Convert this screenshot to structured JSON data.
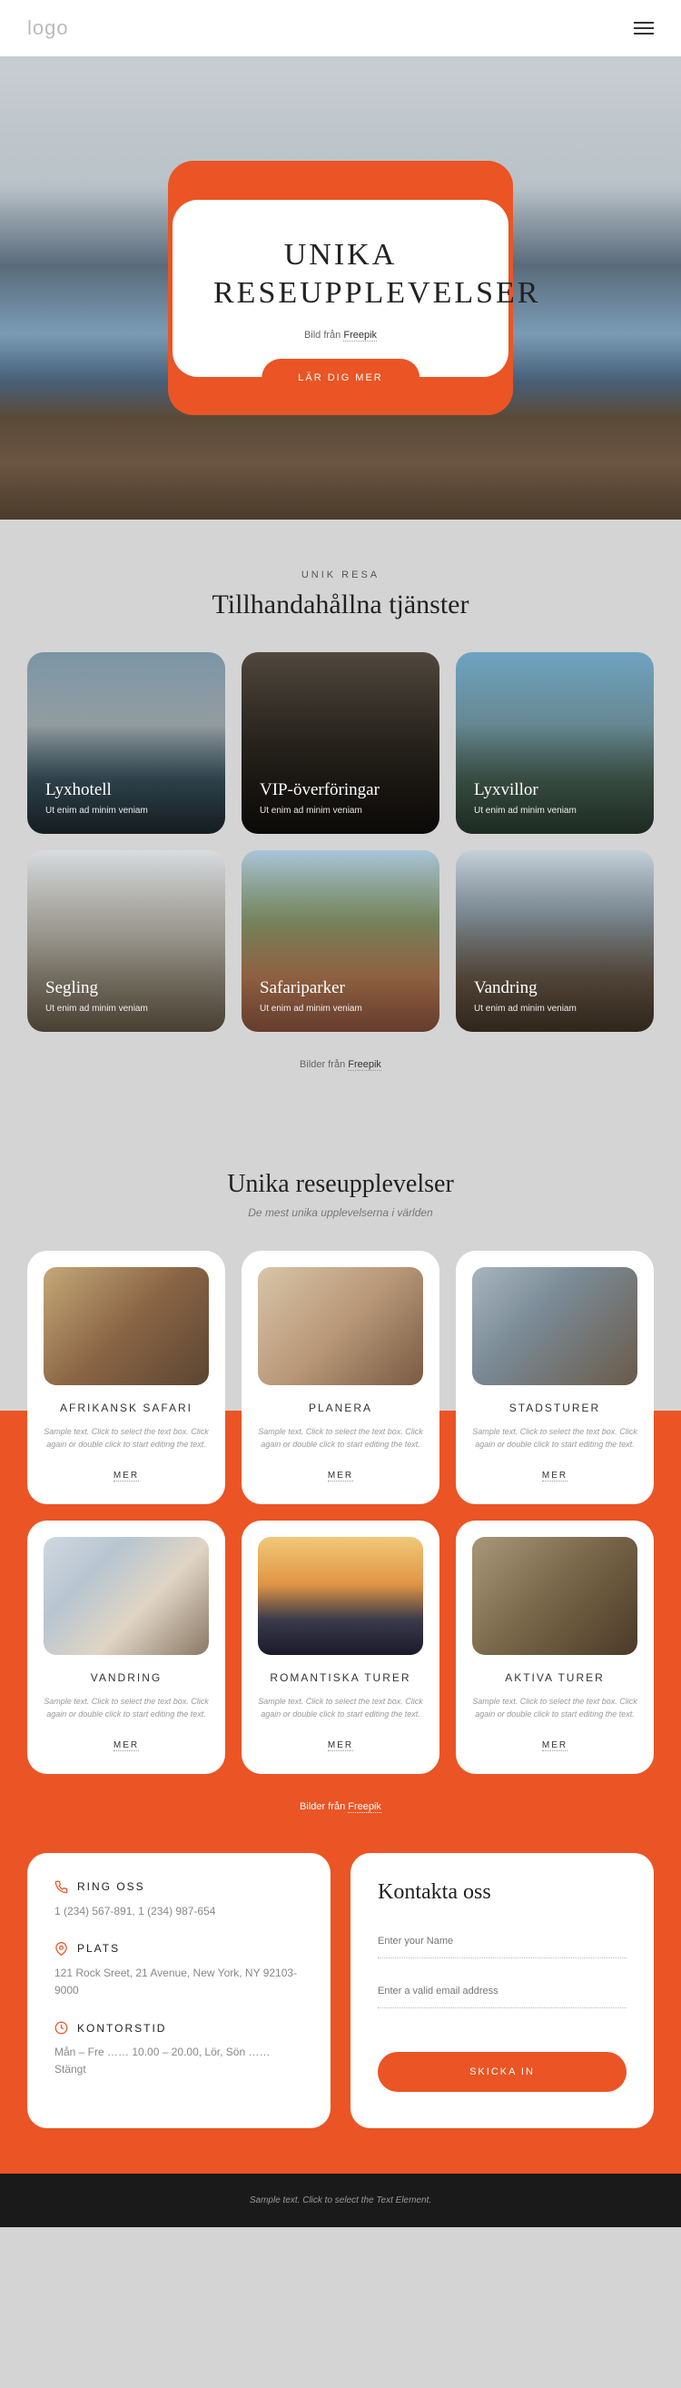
{
  "header": {
    "logo": "logo"
  },
  "hero": {
    "title": "UNIKA RESEUPPLEVELSER",
    "credit_prefix": "Bild från ",
    "credit_link": "Freepik",
    "button": "LÄR DIG MER"
  },
  "services": {
    "eyebrow": "UNIK RESA",
    "title": "Tillhandahållna tjänster",
    "items": [
      {
        "title": "Lyxhotell",
        "text": "Ut enim ad minim veniam"
      },
      {
        "title": "VIP-överföringar",
        "text": "Ut enim ad minim veniam"
      },
      {
        "title": "Lyxvillor",
        "text": "Ut enim ad minim veniam"
      },
      {
        "title": "Segling",
        "text": "Ut enim ad minim veniam"
      },
      {
        "title": "Safariparker",
        "text": "Ut enim ad minim veniam"
      },
      {
        "title": "Vandring",
        "text": "Ut enim ad minim veniam"
      }
    ],
    "credit_prefix": "Bilder från ",
    "credit_link": "Freepik"
  },
  "experiences": {
    "title": "Unika reseupplevelser",
    "subtitle": "De mest unika upplevelserna i världen",
    "items": [
      {
        "title": "AFRIKANSK SAFARI",
        "desc": "Sample text. Click to select the text box. Click again or double click to start editing the text.",
        "more": "MER"
      },
      {
        "title": "PLANERA",
        "desc": "Sample text. Click to select the text box. Click again or double click to start editing the text.",
        "more": "MER"
      },
      {
        "title": "STADSTURER",
        "desc": "Sample text. Click to select the text box. Click again or double click to start editing the text.",
        "more": "MER"
      },
      {
        "title": "VANDRING",
        "desc": "Sample text. Click to select the text box. Click again or double click to start editing the text.",
        "more": "MER"
      },
      {
        "title": "ROMANTISKA TURER",
        "desc": "Sample text. Click to select the text box. Click again or double click to start editing the text.",
        "more": "MER"
      },
      {
        "title": "AKTIVA TURER",
        "desc": "Sample text. Click to select the text box. Click again or double click to start editing the text.",
        "more": "MER"
      }
    ],
    "credit_prefix": "Bilder från ",
    "credit_link": "Freepik"
  },
  "contact": {
    "info": [
      {
        "label": "RING OSS",
        "text": "1 (234) 567-891, 1 (234) 987-654"
      },
      {
        "label": "PLATS",
        "text": "121 Rock Sreet, 21 Avenue, New York, NY 92103-9000"
      },
      {
        "label": "KONTORSTID",
        "text": "Mån – Fre …… 10.00 – 20.00, Lör, Sön …… Stängt"
      }
    ],
    "form": {
      "title": "Kontakta oss",
      "name_placeholder": "Enter your Name",
      "email_placeholder": "Enter a valid email address",
      "submit": "SKICKA IN"
    }
  },
  "footer": {
    "text": "Sample text. Click to select the Text Element."
  }
}
